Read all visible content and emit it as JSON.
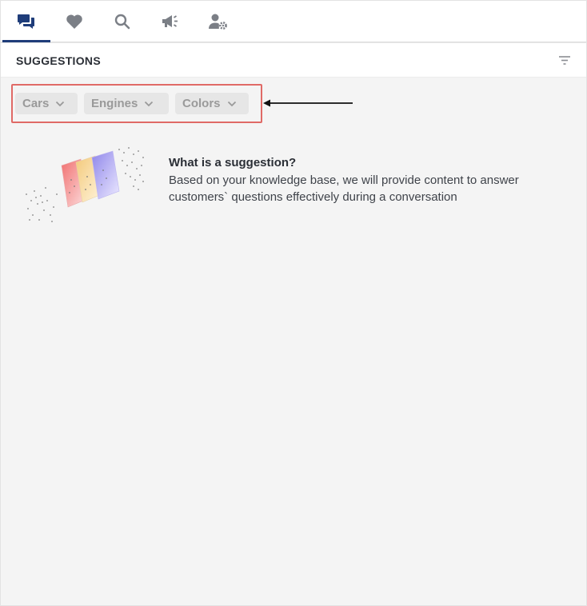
{
  "tabs": [
    {
      "name": "conversations-tab",
      "icon": "chat-bubbles-icon",
      "active": true
    },
    {
      "name": "favorites-tab",
      "icon": "heart-icon",
      "active": false
    },
    {
      "name": "search-tab",
      "icon": "search-icon",
      "active": false
    },
    {
      "name": "announcements-tab",
      "icon": "megaphone-icon",
      "active": false
    },
    {
      "name": "user-settings-tab",
      "icon": "user-gear-icon",
      "active": false
    }
  ],
  "header": {
    "title": "SUGGESTIONS",
    "filter_icon": "filter-lines-icon"
  },
  "filters": [
    {
      "label": "Cars"
    },
    {
      "label": "Engines"
    },
    {
      "label": "Colors"
    }
  ],
  "info": {
    "title": "What is a suggestion?",
    "body": "Based on your knowledge base, we will provide content to answer customers` questions effectively during a conversation"
  },
  "colors": {
    "accent": "#1f3d7a",
    "icon_gray": "#7b7f86",
    "highlight_border": "#e06a66",
    "chip_bg": "#e6e6e6"
  }
}
